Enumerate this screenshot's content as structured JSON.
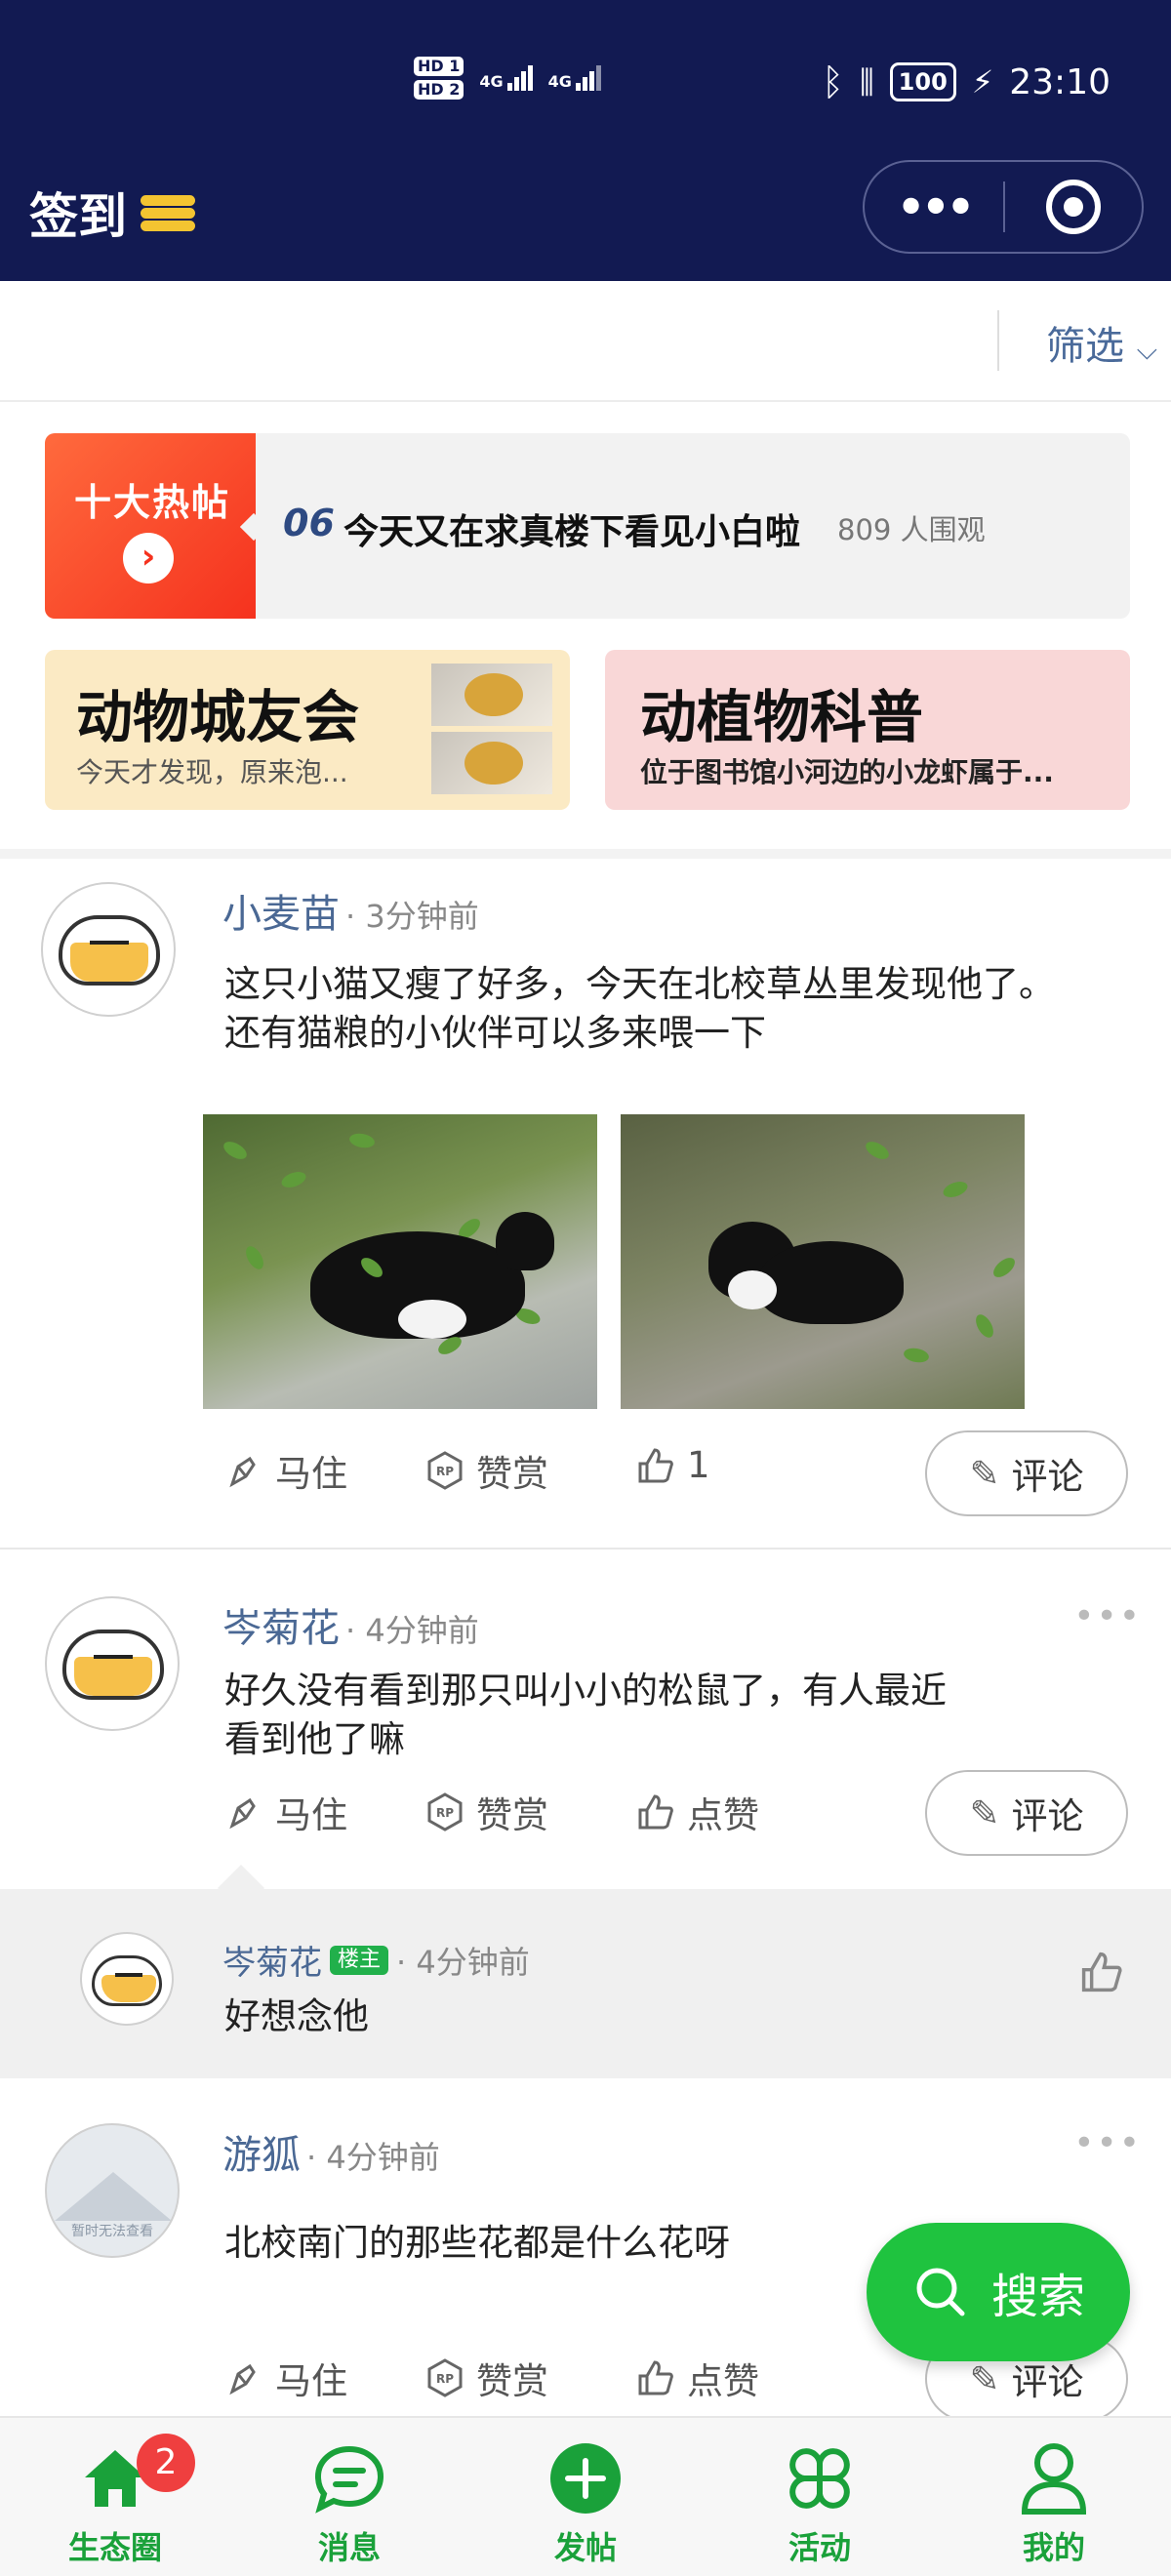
{
  "status_bar": {
    "hd1": "HD 1",
    "hd2": "HD 2",
    "net1": "4G",
    "net2": "4G",
    "battery": "100",
    "time": "23:10"
  },
  "header": {
    "title": "签到"
  },
  "filter": {
    "label": "筛选"
  },
  "hot": {
    "badge": "十大热帖",
    "rank": "06",
    "text": "今天又在求真楼下看见小白啦",
    "views": "809 人围观"
  },
  "cards": [
    {
      "name": "动物城友会",
      "desc": "今天才发现，原来泡..."
    },
    {
      "name": "动植物科普",
      "desc": "位于图书馆小河边的小龙虾属于..."
    }
  ],
  "posts": [
    {
      "user": "小麦苗",
      "time": "· 3分钟前",
      "body": [
        "这只小猫又瘦了好多，今天在北校草丛里发现他了。",
        "还有猫粮的小伙伴可以多来喂一下"
      ],
      "like_text": "1"
    },
    {
      "user": "岑菊花",
      "time": "· 4分钟前",
      "body": [
        "好久没有看到那只叫小小的松鼠了，有人最近",
        "看到他了嘛"
      ],
      "like_text": "点赞"
    },
    {
      "user": "游狐",
      "time": "· 4分钟前",
      "body": [
        "北校南门的那些花都是什么花呀"
      ],
      "like_text": "点赞",
      "avatar_text": "暂时无法查看"
    }
  ],
  "actions": {
    "save": "马住",
    "reward": "赞赏",
    "comment": "评论"
  },
  "reply": {
    "user": "岑菊花",
    "badge": "楼主",
    "time": "· 4分钟前",
    "text": "好想念他"
  },
  "search": {
    "label": "搜索"
  },
  "tabs": [
    {
      "label": "生态圈",
      "badge": "2"
    },
    {
      "label": "消息"
    },
    {
      "label": "发帖"
    },
    {
      "label": "活动"
    },
    {
      "label": "我的"
    }
  ],
  "colors": {
    "header_bg": "#121a52",
    "accent_green": "#1fc33f",
    "tab_green": "#1aa13a",
    "name_blue": "#4a6894",
    "hot_red": "#f5321e"
  }
}
